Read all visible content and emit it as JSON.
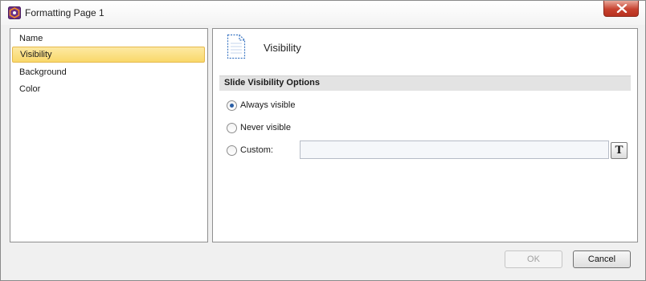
{
  "window": {
    "title": "Formatting Page 1"
  },
  "nav": {
    "items": [
      {
        "label": "Name"
      },
      {
        "label": "Visibility",
        "selected": true
      },
      {
        "label": "Background"
      },
      {
        "label": "Color"
      }
    ]
  },
  "content": {
    "header_title": "Visibility",
    "section_title": "Slide Visibility Options",
    "options": [
      {
        "label": "Always visible",
        "checked": true
      },
      {
        "label": "Never visible",
        "checked": false
      },
      {
        "label": "Custom:",
        "checked": false
      }
    ],
    "custom_value": "",
    "text_button_glyph": "T"
  },
  "footer": {
    "ok_label": "OK",
    "ok_enabled": false,
    "cancel_label": "Cancel"
  },
  "colors": {
    "selection": "#f9d86a",
    "close_button": "#c7422f",
    "radio_dot": "#2b5fa6"
  }
}
